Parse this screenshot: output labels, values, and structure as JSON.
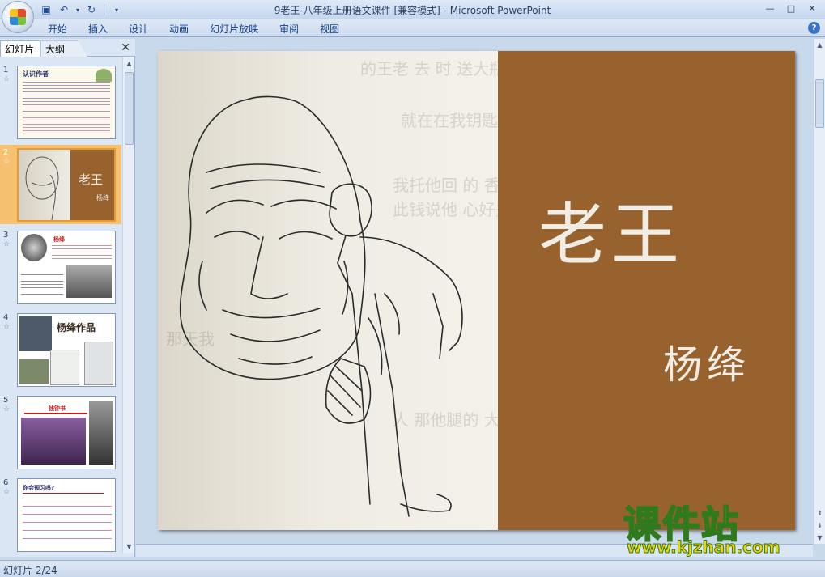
{
  "window": {
    "title": "9老王-八年级上册语文课件 [兼容模式] - Microsoft PowerPoint",
    "controls": [
      "—",
      "□",
      "✕"
    ]
  },
  "qat": {
    "save_icon": "save-icon",
    "undo_icon": "undo-icon",
    "redo_icon": "redo-icon",
    "customize_icon": "customize-qat-icon"
  },
  "ribbon": {
    "tabs": [
      "开始",
      "插入",
      "设计",
      "动画",
      "幻灯片放映",
      "审阅",
      "视图"
    ],
    "help": "?"
  },
  "left_pane": {
    "tabs": [
      "幻灯片",
      "大纲"
    ],
    "close": "✕",
    "thumbnails": [
      {
        "num": "1",
        "star": "☆",
        "title": "认识作者",
        "selected": false
      },
      {
        "num": "2",
        "star": "☆",
        "title": "老王",
        "author": "杨绛",
        "selected": true
      },
      {
        "num": "3",
        "star": "☆",
        "title": "杨绛",
        "selected": false
      },
      {
        "num": "4",
        "star": "☆",
        "title": "杨绛作品",
        "selected": false
      },
      {
        "num": "5",
        "star": "☆",
        "title": "钱钟书",
        "selected": false
      },
      {
        "num": "6",
        "star": "☆",
        "title": "你会预习吗?",
        "selected": false
      }
    ]
  },
  "slide": {
    "title": "老王",
    "author": "杨绛",
    "brown_color": "#98622f"
  },
  "status": {
    "slide_counter": "幻灯片 2/24"
  },
  "watermark": {
    "text": "课件站",
    "url": "www.kjzhan.com"
  }
}
